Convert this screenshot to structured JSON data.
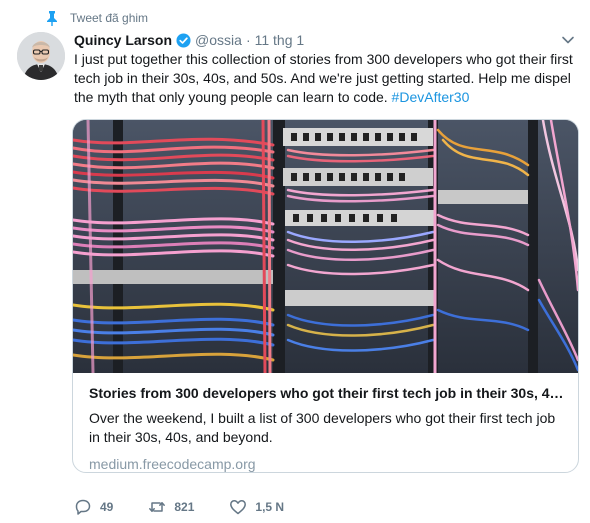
{
  "pinned": {
    "label": "Tweet đã ghim",
    "icon": "pin-icon"
  },
  "tweet": {
    "author_name": "Quincy Larson",
    "handle": "@ossia",
    "separator": "·",
    "time": "11 thg 1",
    "text": "I just put together this collection of stories from 300 developers who got their first tech job in their 30s, 40s, and 50s. And we're just getting started. Help me dispel the myth that only young people can learn to code.",
    "hashtag": "#DevAfter30"
  },
  "card": {
    "title": "Stories from 300 developers who got their first tech job in their 30s, 4…",
    "description": "Over the weekend, I built a list of 300 developers who got their first tech job in their 30s, 40s, and beyond.",
    "domain": "medium.freecodecamp.org"
  },
  "actions": {
    "reply_count": "49",
    "retweet_count": "821",
    "like_count": "1,5 N"
  },
  "colors": {
    "link": "#1b95e0",
    "secondary_text": "#657786",
    "verified": "#1da1f2",
    "pin": "#1da1f2"
  }
}
